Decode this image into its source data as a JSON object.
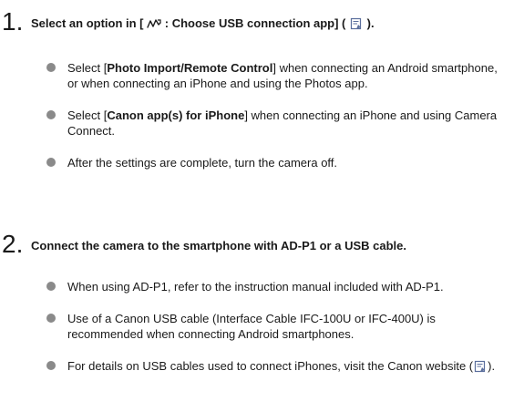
{
  "step1": {
    "number": "1.",
    "title_prefix": "Select an option in [",
    "menu_icon": "usb-connection-icon",
    "title_menu": ": Choose USB connection app] (",
    "ref_icon": "page-reference-icon",
    "title_suffix": ").",
    "bullets": [
      {
        "pre": "Select [",
        "bold": "Photo Import/Remote Control",
        "post": "] when connecting an Android smartphone, or when connecting an iPhone and using the Photos app."
      },
      {
        "pre": "Select [",
        "bold": "Canon app(s) for iPhone",
        "post": "] when connecting an iPhone and using Camera Connect."
      },
      {
        "text": "After the settings are complete, turn the camera off."
      }
    ]
  },
  "step2": {
    "number": "2.",
    "title": "Connect the camera to the smartphone with AD-P1 or a USB cable.",
    "bullets": [
      {
        "text": "When using AD-P1, refer to the instruction manual included with AD-P1."
      },
      {
        "text": "Use of a Canon USB cable (Interface Cable IFC-100U or IFC-400U) is recommended when connecting Android smartphones."
      },
      {
        "pre": "For details on USB cables used to connect iPhones, visit the Canon website (",
        "post": ")."
      }
    ]
  },
  "colors": {
    "text": "#1a1a1a",
    "bullet": "#8a8a8a",
    "ref_icon": "#5a6e9c"
  }
}
